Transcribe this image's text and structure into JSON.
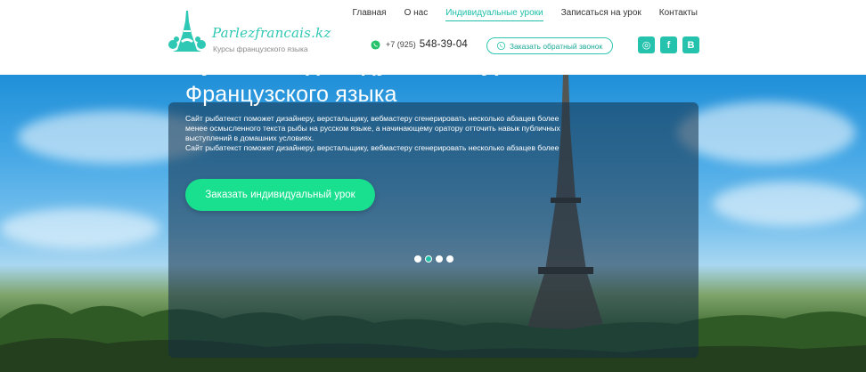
{
  "logo": {
    "title": "Parlezfrancais.kz",
    "subtitle": "Курсы французского языка",
    "icon": "eiffel-tower-icon"
  },
  "nav": {
    "items": [
      {
        "label": "Главная",
        "active": false
      },
      {
        "label": "О нас",
        "active": false
      },
      {
        "label": "Индивидуальные уроки",
        "active": true
      },
      {
        "label": "Записаться на урок",
        "active": false
      },
      {
        "label": "Контакты",
        "active": false
      }
    ]
  },
  "contact": {
    "phone_code": "+7 (925)",
    "phone_number": "548-39-04",
    "icon": "whatsapp-icon"
  },
  "callback": {
    "label": "Заказать обратный звонок",
    "icon": "phone-icon"
  },
  "social": [
    {
      "name": "instagram-icon",
      "glyph": "◎"
    },
    {
      "name": "facebook-icon",
      "glyph": "f"
    },
    {
      "name": "vk-icon",
      "glyph": "B"
    }
  ],
  "hero": {
    "title": "Лучшие индивидуальные уроки",
    "subtitle": "Французского языка",
    "text": "Сайт рыбатекст поможет дизайнеру, верстальщику, вебмастеру сгенерировать несколько абзацев более менее осмысленного текста рыбы на русском языке, а начинающему оратору отточить навык публичных выступлений в домашних условиях.",
    "text2": "Сайт рыбатекст поможет дизайнеру, верстальщику, вебмастеру сгенерировать несколько абзацев более",
    "cta": "Заказать индивидуальный урок",
    "slides": 4,
    "active_slide": 1
  },
  "colors": {
    "accent": "#1fbfa9",
    "cta": "#18e08e"
  }
}
